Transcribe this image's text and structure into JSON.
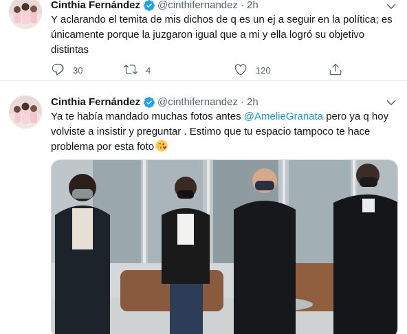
{
  "tweets": [
    {
      "display_name": "Cinthia Fernández",
      "handle": "@cinthifernandez",
      "separator": "·",
      "time": "2h",
      "text": "Y aclarando el temita de mis dichos de q es un ej a seguir en la política; es únicamente porque la juzgaron igual que a mi y ella logró su objetivo distintas",
      "replies": "30",
      "retweets": "4",
      "likes": "120"
    },
    {
      "display_name": "Cinthia Fernández",
      "handle": "@cinthifernandez",
      "separator": "·",
      "time": "2h",
      "text_before": "Ya te había mandado muchas fotos antes ",
      "mention": "@AmelieGranata",
      "text_after": " pero ya q hoy volviste a insistir y preguntar . Estimo que tu espacio tampoco te hace problema por esta foto",
      "emoji": "face-blowing-a-kiss"
    }
  ],
  "icons": {
    "verified": "verified-badge-icon",
    "more": "chevron-down-icon",
    "reply": "reply-icon",
    "retweet": "retweet-icon",
    "like": "heart-icon",
    "share": "share-icon"
  },
  "colors": {
    "verified": "#1da1f2",
    "link": "#1b95e0",
    "secondary_text": "#536471",
    "divider": "#e1e8ed"
  }
}
